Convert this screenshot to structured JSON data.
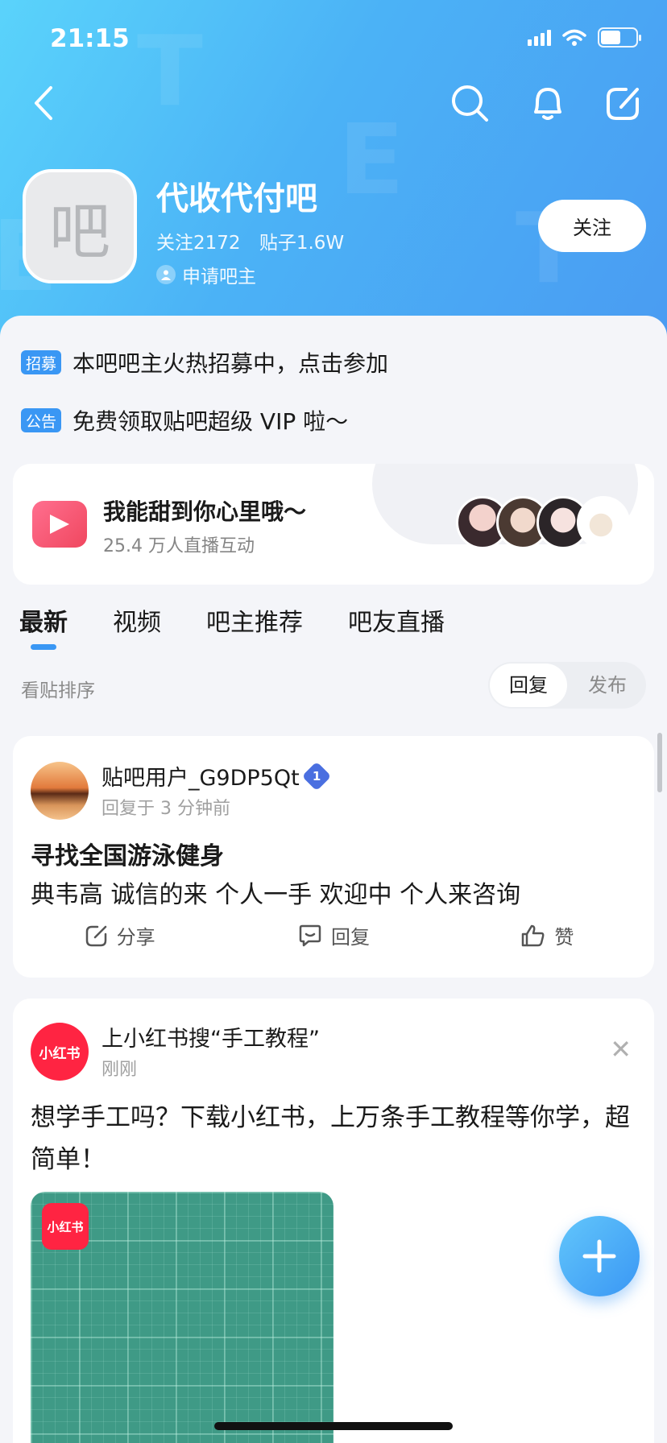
{
  "status_bar": {
    "time": "21:15"
  },
  "forum": {
    "avatar_char": "吧",
    "name": "代收代付吧",
    "followers": "关注2172",
    "posts": "贴子1.6W",
    "apply_admin": "申请吧主",
    "follow_label": "关注"
  },
  "notices": [
    {
      "tag": "招募",
      "text": "本吧吧主火热招募中，点击参加"
    },
    {
      "tag": "公告",
      "text": "免费领取贴吧超级 VIP 啦～"
    }
  ],
  "live": {
    "title": "我能甜到你心里哦～",
    "subtitle": "25.4 万人直播互动"
  },
  "tabs": [
    "最新",
    "视频",
    "吧主推荐",
    "吧友直播"
  ],
  "sort": {
    "label": "看贴排序",
    "options": [
      "回复",
      "发布"
    ],
    "selected": "回复"
  },
  "post": {
    "username": "贴吧用户_G9DP5Qt",
    "level": "1",
    "time": "回复于 3 分钟前",
    "title": "寻找全国游泳健身",
    "body": "典韦高  诚信的来  个人一手  欢迎中  个人来咨询",
    "actions": {
      "share": "分享",
      "reply": "回复",
      "like": "赞"
    }
  },
  "ad": {
    "logo": "小红书",
    "title": "上小红书搜“手工教程”",
    "time": "刚刚",
    "body": "想学手工吗？下载小红书，上万条手工教程等你学，超简单！",
    "image_logo": "小红书"
  },
  "colors": {
    "accent": "#3a97f4",
    "header_start": "#5ad3fb",
    "header_end": "#4a9cf2",
    "xhs_red": "#ff2442"
  }
}
